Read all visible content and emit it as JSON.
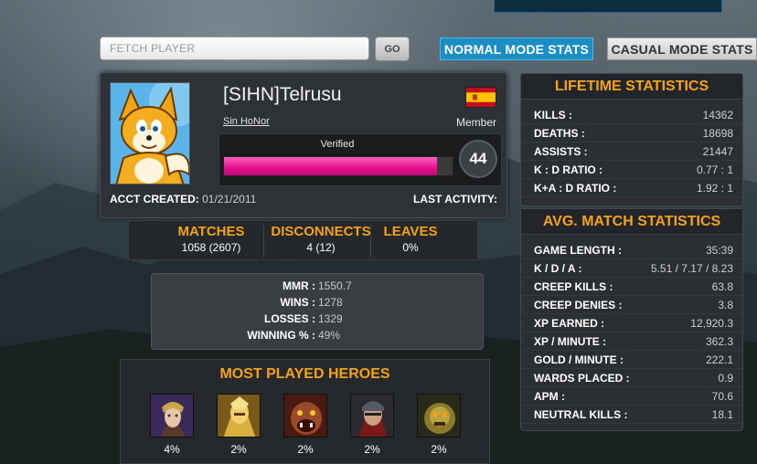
{
  "search": {
    "placeholder": "FETCH PLAYER",
    "go_label": "GO"
  },
  "tabs": {
    "normal": "NORMAL MODE STATS",
    "casual": "CASUAL MODE STATS"
  },
  "profile": {
    "name": "[SIHN]Telrusu",
    "clan": "Sin HoNor",
    "role": "Member",
    "verified_label": "Verified",
    "level": "44",
    "level_progress": 0.93,
    "acct_created_label": "ACCT CREATED:",
    "acct_created_value": "01/21/2011",
    "last_activity_label": "LAST ACTIVITY:",
    "flag_icon": "spain-flag-icon",
    "avatar_icon": "fox-avatar-icon"
  },
  "summary": {
    "matches": {
      "label": "MATCHES",
      "value": "1058 (2607)"
    },
    "disconnects": {
      "label": "DISCONNECTS",
      "value": "4 (12)"
    },
    "leaves": {
      "label": "LEAVES",
      "value": "0%"
    }
  },
  "rating": [
    {
      "label": "MMR :",
      "value": "1550.7"
    },
    {
      "label": "WINS :",
      "value": "1278"
    },
    {
      "label": "LOSSES :",
      "value": "1329"
    },
    {
      "label": "WINNING % :",
      "value": "49%"
    }
  ],
  "heroes": {
    "title": "MOST PLAYED HEROES",
    "items": [
      {
        "icon": "hero-sorceress-portrait",
        "pct": "4%"
      },
      {
        "icon": "hero-golden-knight-portrait",
        "pct": "2%"
      },
      {
        "icon": "hero-beast-portrait",
        "pct": "2%"
      },
      {
        "icon": "hero-warrior-portrait",
        "pct": "2%"
      },
      {
        "icon": "hero-golem-portrait",
        "pct": "2%"
      }
    ]
  },
  "lifetime": {
    "title": "LIFETIME STATISTICS",
    "rows": [
      {
        "label": "KILLS :",
        "value": "14362"
      },
      {
        "label": "DEATHS :",
        "value": "18698"
      },
      {
        "label": "ASSISTS :",
        "value": "21447"
      },
      {
        "label": "K : D RATIO :",
        "value": "0.77 : 1"
      },
      {
        "label": "K+A : D RATIO :",
        "value": "1.92 : 1"
      }
    ]
  },
  "avg": {
    "title": "AVG. MATCH STATISTICS",
    "rows": [
      {
        "label": "GAME LENGTH :",
        "value": "35:39"
      },
      {
        "label": "K / D / A :",
        "value": "5.51 / 7.17 / 8.23"
      },
      {
        "label": "CREEP KILLS :",
        "value": "63.8"
      },
      {
        "label": "CREEP DENIES :",
        "value": "3.8"
      },
      {
        "label": "XP EARNED :",
        "value": "12,920.3"
      },
      {
        "label": "XP / MINUTE :",
        "value": "362.3"
      },
      {
        "label": "GOLD / MINUTE :",
        "value": "222.1"
      },
      {
        "label": "WARDS PLACED :",
        "value": "0.9"
      },
      {
        "label": "APM :",
        "value": "70.6"
      },
      {
        "label": "NEUTRAL KILLS :",
        "value": "18.1"
      }
    ]
  },
  "colors": {
    "accent_orange": "#f4a21c",
    "tab_blue": "#1b8fc4",
    "progress_pink": "#e8108e"
  }
}
